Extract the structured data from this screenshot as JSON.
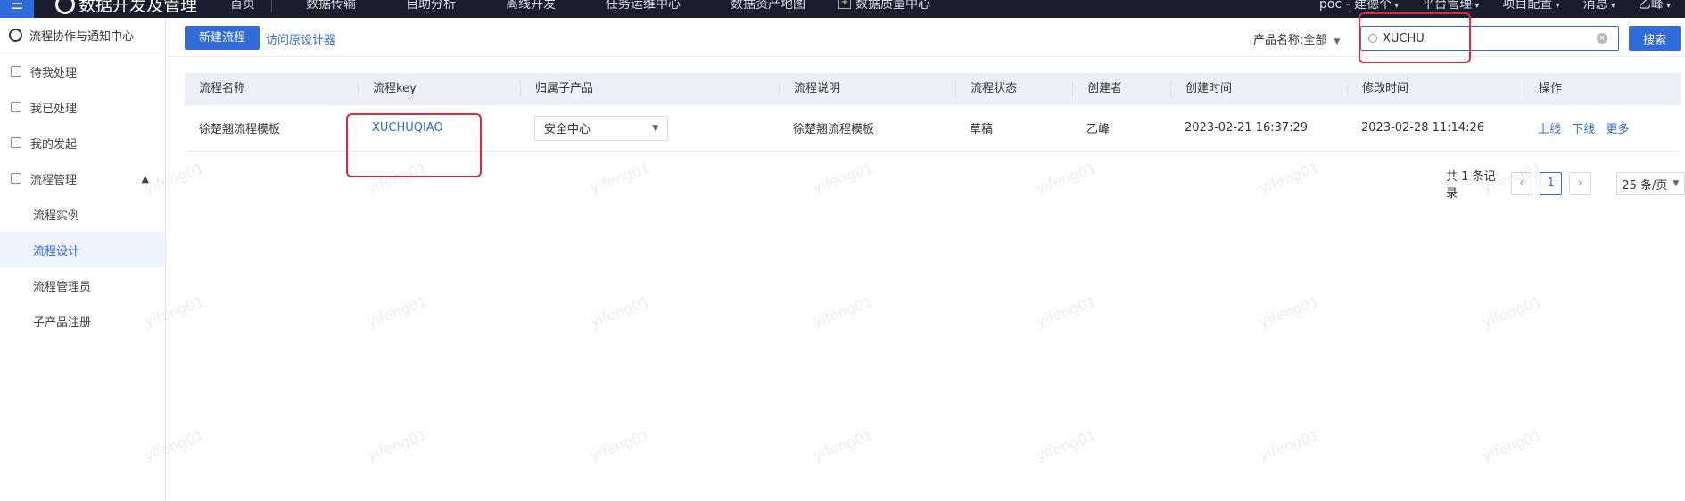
{
  "topbar": {
    "logo_glyph": "☰",
    "brand": "数据开发及管理",
    "nav": [
      "首页",
      "数据传输",
      "自助分析",
      "离线开发",
      "任务运维中心",
      "数据资产地图",
      "数据质量中心"
    ],
    "right": [
      "poc - 建德个",
      "平台管理",
      "项目配置",
      "消息",
      "乙峰"
    ]
  },
  "sidebar": {
    "title": "流程协作与通知中心",
    "items": [
      {
        "label": "待我处理"
      },
      {
        "label": "我已处理"
      },
      {
        "label": "我的发起"
      },
      {
        "label": "流程管理"
      }
    ],
    "subitems": [
      {
        "label": "流程实例"
      },
      {
        "label": "流程设计"
      },
      {
        "label": "流程管理员"
      },
      {
        "label": "子产品注册"
      }
    ]
  },
  "toolbar": {
    "new_flow": "新建流程",
    "visit_old": "访问原设计器",
    "product_filter": "产品名称:全部",
    "search_value": "XUCHU",
    "search_button": "搜索"
  },
  "table": {
    "headers": [
      "流程名称",
      "流程key",
      "归属子产品",
      "流程说明",
      "流程状态",
      "创建者",
      "创建时间",
      "修改时间",
      "操作"
    ],
    "rows": [
      {
        "name": "徐楚翘流程模板",
        "key": "XUCHUQIAO",
        "subproduct": "安全中心",
        "description": "徐楚翘流程模板",
        "status": "草稿",
        "creator": "乙峰",
        "created": "2023-02-21 16:37:29",
        "modified": "2023-02-28 11:14:26",
        "ops": [
          "上线",
          "下线",
          "更多"
        ]
      }
    ]
  },
  "pagination": {
    "total": "共 1 条记录",
    "current": "1",
    "page_size": "25 条/页"
  },
  "watermark": "yifeng01",
  "colors": {
    "primary": "#2f6bd9",
    "topbar": "#1a1e2c",
    "highlight": "#e02a3c"
  }
}
